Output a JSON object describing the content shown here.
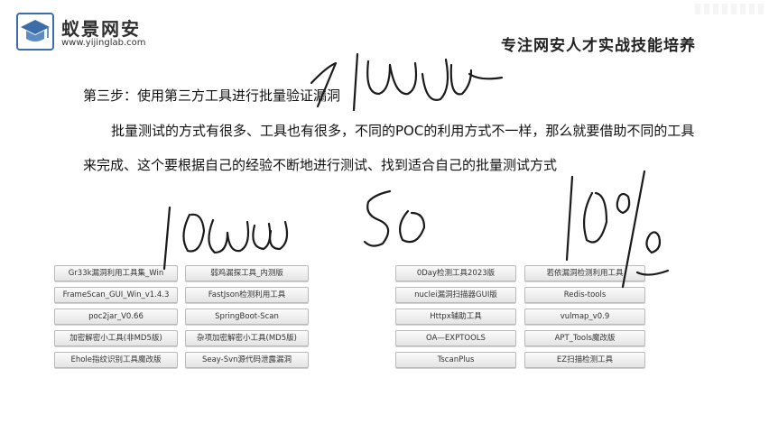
{
  "header": {
    "brand_name": "蚁景网安",
    "brand_url": "www.yijinglab.com",
    "tagline": "专注网安人才实战技能培养",
    "logo_icon": "graduation-cap-icon"
  },
  "content": {
    "step_title": "第三步：使用第三方工具进行批量验证漏洞",
    "paragraph_1": "批量测试的方式有很多、工具也有很多，不同的POC的利用方式不一样，那么就要借助不同的工具",
    "paragraph_2": "来完成、这个要根据自己的经验不断地进行测试、找到适合自己的批量测试方式"
  },
  "tools_left": [
    "Gr33k漏洞利用工具集_Win",
    "弱鸡漏探工具_内测版",
    "FrameScan_GUI_Win_v1.4.3",
    "FastJson检测利用工具",
    "poc2jar_V0.66",
    "SpringBoot-Scan",
    "加密解密小工具(非MD5版)",
    "杂项加密解密小工具(MD5版)",
    "Ehole指纹识别工具魔改版",
    "Seay-Svn源代码泄露漏洞"
  ],
  "tools_right": [
    "0Day检测工具2023版",
    "若依漏洞检测利用工具",
    "nuclei漏洞扫描器GUI版",
    "Redis-tools",
    "Httpx辅助工具",
    "vulmap_v0.9",
    "OA—EXPTOOLS",
    "APT_Tools魔改版",
    "TscanPlus",
    "EZ扫描检测工具"
  ],
  "colors": {
    "ink": "#1a1a1a",
    "button_border": "#b9b9b9",
    "logo_blue": "#3b6ea8"
  }
}
